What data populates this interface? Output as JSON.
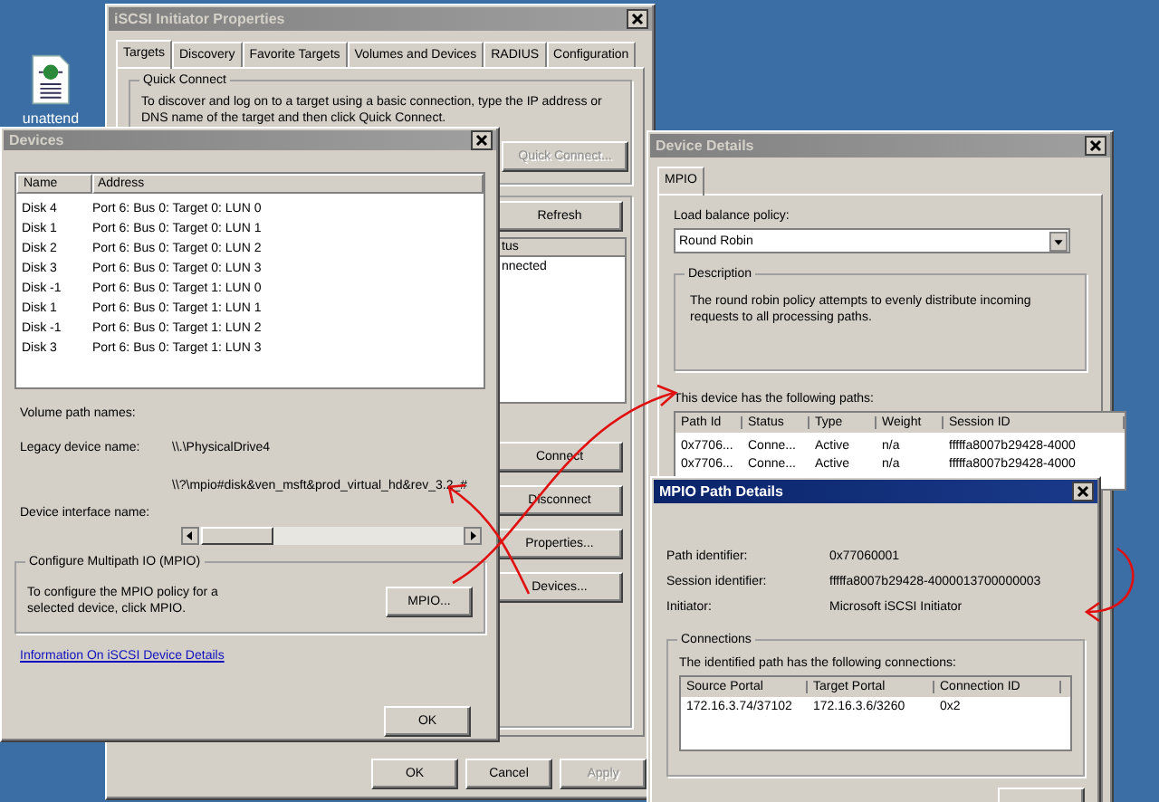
{
  "desktop": {
    "icons": [
      {
        "label": "unattend"
      }
    ]
  },
  "properties_window": {
    "title": "iSCSI Initiator Properties",
    "tabs": [
      {
        "label": "Targets",
        "selected": true
      },
      {
        "label": "Discovery",
        "selected": false
      },
      {
        "label": "Favorite Targets",
        "selected": false
      },
      {
        "label": "Volumes and Devices",
        "selected": false
      },
      {
        "label": "RADIUS",
        "selected": false
      },
      {
        "label": "Configuration",
        "selected": false
      }
    ],
    "quick_connect": {
      "legend": "Quick Connect",
      "text": "To discover and log on to a target using a basic connection, type the IP address or DNS name of the target and then click Quick Connect.",
      "button": {
        "label": "Quick Connect...",
        "disabled": true
      }
    },
    "refresh_button": "Refresh",
    "targets_table": {
      "column": "tus",
      "cell": "nnected"
    },
    "side_buttons": [
      "Connect",
      "Disconnect",
      "Properties...",
      "Devices..."
    ],
    "footer_buttons": [
      {
        "label": "OK",
        "disabled": false
      },
      {
        "label": "Cancel",
        "disabled": false
      },
      {
        "label": "Apply",
        "disabled": true
      }
    ]
  },
  "devices_window": {
    "title": "Devices",
    "columns": [
      "Name",
      "Address"
    ],
    "rows": [
      {
        "name": "Disk 4",
        "address": "Port 6: Bus 0: Target 0: LUN 0"
      },
      {
        "name": "Disk 1",
        "address": "Port 6: Bus 0: Target 0: LUN 1"
      },
      {
        "name": "Disk 2",
        "address": "Port 6: Bus 0: Target 0: LUN 2"
      },
      {
        "name": "Disk 3",
        "address": "Port 6: Bus 0: Target 0: LUN 3"
      },
      {
        "name": "Disk -1",
        "address": "Port 6: Bus 0: Target 1: LUN 0"
      },
      {
        "name": "Disk 1",
        "address": "Port 6: Bus 0: Target 1: LUN 1"
      },
      {
        "name": "Disk -1",
        "address": "Port 6: Bus 0: Target 1: LUN 2"
      },
      {
        "name": "Disk 3",
        "address": "Port 6: Bus 0: Target 1: LUN 3"
      }
    ],
    "volume_path_label": "Volume path names:",
    "legacy_label": "Legacy device name:",
    "legacy_value": "\\\\.\\PhysicalDrive4",
    "interface_label": "Device interface name:",
    "interface_value": "\\\\?\\mpio#disk&ven_msft&prod_virtual_hd&rev_3.2_#",
    "mpio_group": {
      "legend": "Configure Multipath IO (MPIO)",
      "text": "To configure the MPIO policy for a selected device, click MPIO.",
      "button": "MPIO..."
    },
    "link": "Information On iSCSI Device Details",
    "ok_button": "OK"
  },
  "details_window": {
    "title": "Device Details",
    "tabs": [
      {
        "label": "MPIO",
        "selected": true
      }
    ],
    "policy_label": "Load balance policy:",
    "policy_value": "Round Robin",
    "description_legend": "Description",
    "description": "The round robin policy attempts to evenly distribute incoming requests to all processing paths.",
    "paths_label": "This device has the following paths:",
    "columns": [
      "Path Id",
      "Status",
      "Type",
      "Weight",
      "Session ID"
    ],
    "rows": [
      [
        "0x7706...",
        "Conne...",
        "Active",
        "n/a",
        "fffffa8007b29428-4000"
      ],
      [
        "0x7706...",
        "Conne...",
        "Active",
        "n/a",
        "fffffa8007b29428-4000"
      ]
    ]
  },
  "path_window": {
    "title": "MPIO Path Details",
    "fields": [
      {
        "label": "Path identifier:",
        "value": "0x77060001"
      },
      {
        "label": "Session identifier:",
        "value": "fffffa8007b29428-4000013700000003"
      },
      {
        "label": "Initiator:",
        "value": "Microsoft iSCSI Initiator"
      }
    ],
    "connections_legend": "Connections",
    "connections_text": "The identified path has the following connections:",
    "columns": [
      "Source Portal",
      "Target Portal",
      "Connection ID"
    ],
    "rows": [
      [
        "172.16.3.74/37102",
        "172.16.3.6/3260",
        "0x2"
      ]
    ]
  }
}
